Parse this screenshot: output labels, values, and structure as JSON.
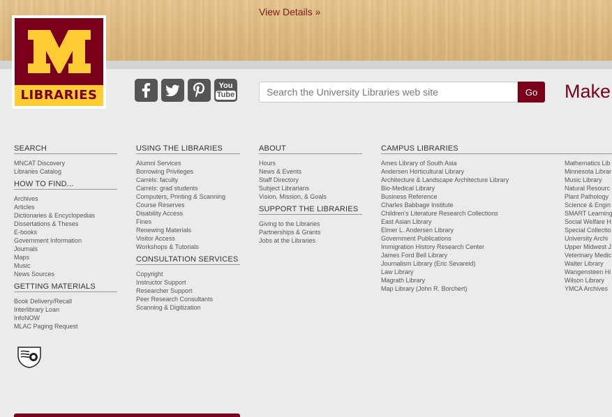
{
  "hero": {
    "view_details": "View Details »"
  },
  "logo": {
    "text": "LIBRARIES"
  },
  "social": [
    "facebook-icon",
    "twitter-icon",
    "pinterest-icon",
    "youtube-icon"
  ],
  "youtube_text_1": "You",
  "youtube_text_2": "Tube",
  "search": {
    "placeholder": "Search the University Libraries web site",
    "button": "Go"
  },
  "promo": {
    "text": "Make a"
  },
  "colors": {
    "maroon": "#7a0019",
    "gold": "#ffcc33"
  },
  "sections": {
    "search": {
      "title": "SEARCH",
      "links": [
        "MNCAT Discovery",
        "Libraries Catalog"
      ]
    },
    "how_to_find": {
      "title": "HOW TO FIND...",
      "links": [
        "Archives",
        "Articles",
        "Dictionaries & Encyclopedias",
        "Dissertations & Theses",
        "E-books",
        "Government Information",
        "Journals",
        "Maps",
        "Music",
        "News Sources"
      ]
    },
    "getting_materials": {
      "title": "GETTING MATERIALS",
      "links": [
        "Book Delivery/Recall",
        "Interlibrary Loan",
        "InfoNOW",
        "MLAC Paging Request"
      ]
    },
    "using": {
      "title": "USING THE LIBRARIES",
      "links": [
        "Alumni Services",
        "Borrowing Privileges",
        "Carrels: faculty",
        "Carrels: grad students",
        "Computers, Printing & Scanning",
        "Course Reserves",
        "Disability Access",
        "Fines",
        "Renewing Materials",
        "Visitor Access",
        "Workshops & Tutorials"
      ]
    },
    "consultation": {
      "title": "CONSULTATION SERVICES",
      "links": [
        "Copyright",
        "Instructor Support",
        "Researcher Support",
        "Peer Research Consultants",
        "Scanning & Digitization"
      ]
    },
    "about": {
      "title": "ABOUT",
      "links": [
        "Hours",
        "News & Events",
        "Staff Directory",
        "Subject Librarians",
        "Vision, Mission, & Goals"
      ]
    },
    "support": {
      "title": "SUPPORT THE LIBRARIES",
      "links": [
        "Giving to the Libraries",
        "Partnerships & Grants",
        "Jobs at the Libraries"
      ]
    },
    "campus": {
      "title": "CAMPUS LIBRARIES",
      "links": [
        "Ames Library of South Asia",
        "Andersen Horticultural Library",
        "Architecture & Landscape Architecture Library",
        "Bio-Medical Library",
        "Business Reference",
        "Charles Babbage Institute",
        "Children's Literature Research Collections",
        "East Asian Library",
        "Elmer L. Andersen Library",
        "Government Publications",
        "Immigration History Research Center",
        "James Ford Bell Library",
        "Journalism Library (Eric Sevareid)",
        "Law Library",
        "Magrath Library",
        "Map Library (John R. Borchert)"
      ]
    },
    "campus2": {
      "links": [
        "Mathematics Lib",
        "Minnesota Librar",
        "Music Library",
        "Natural Resourc",
        "Plant Pathology",
        "Science & Engin",
        "SMART Learning",
        "Social Welfare H",
        "Special Collectio",
        "University Archi",
        "Upper Midwest J",
        "Veterinary Medic",
        "Walter Library",
        "Wangensteen Hi",
        "Wilson Library",
        "YMCA Archives"
      ]
    }
  }
}
